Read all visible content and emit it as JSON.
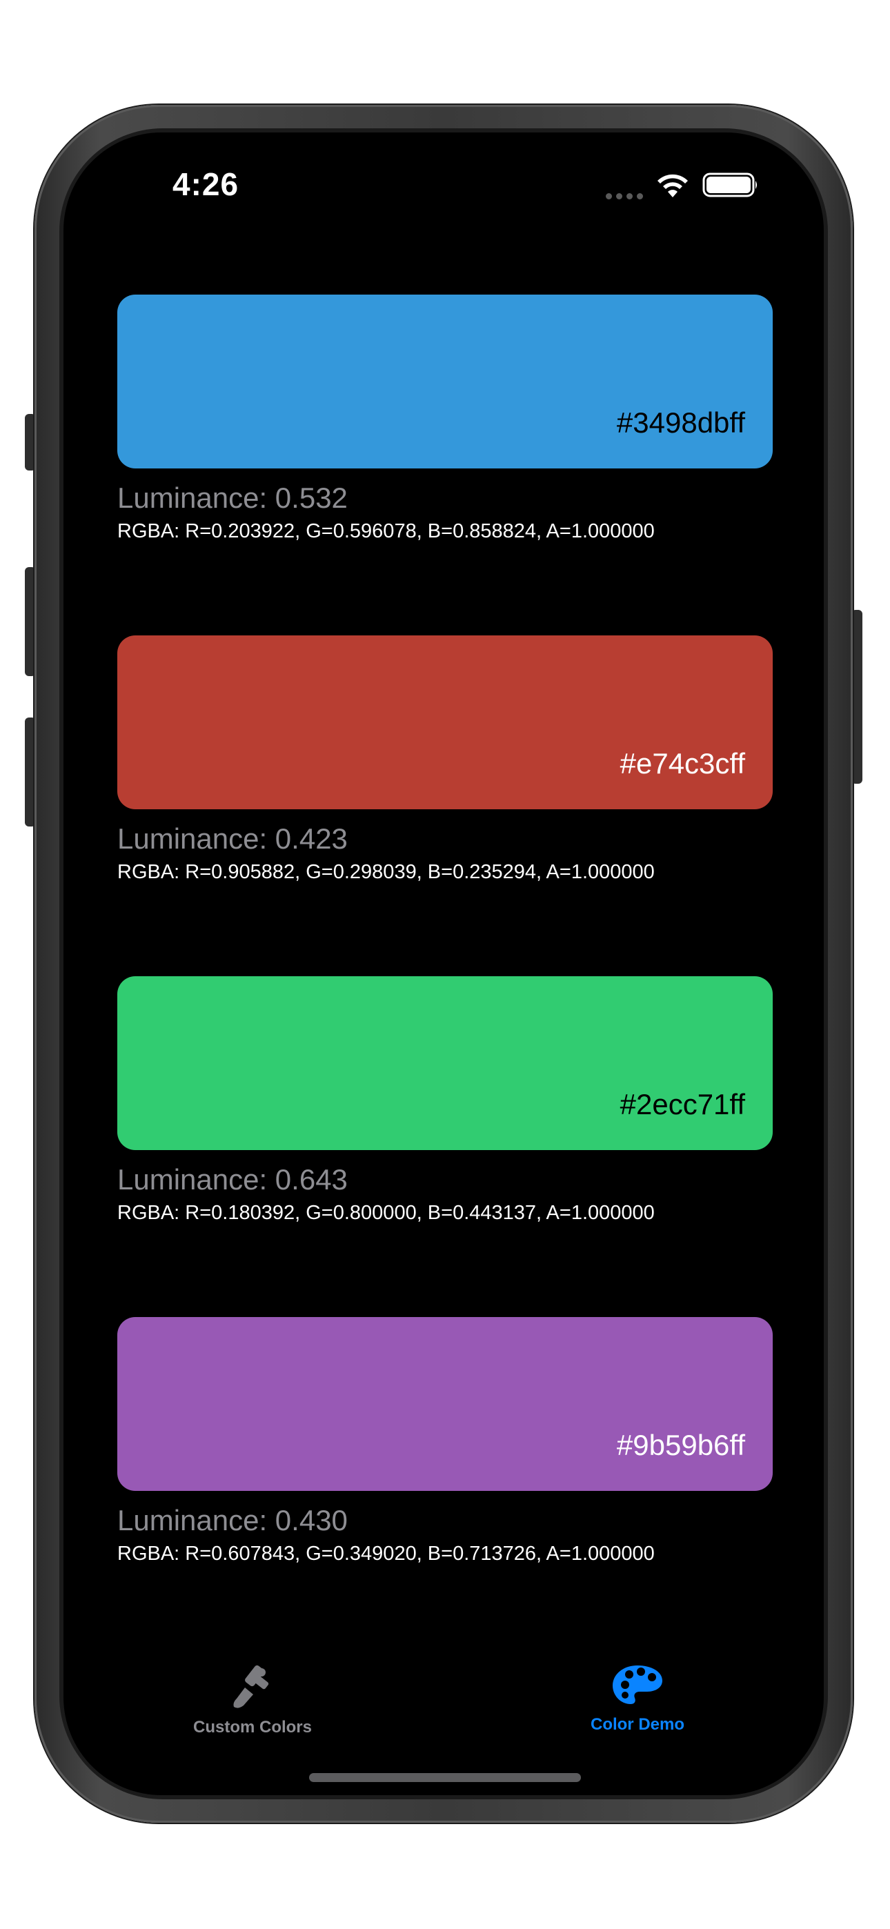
{
  "status_bar": {
    "time": "4:26",
    "icons": [
      "cellular-dots-icon",
      "wifi-icon",
      "battery-icon"
    ]
  },
  "colors": [
    {
      "hex": "#3498dbff",
      "swatch_color": "#3498db",
      "text_color": "#000000",
      "luminance_label": "Luminance: 0.532",
      "rgba_label": "RGBA: R=0.203922, G=0.596078, B=0.858824, A=1.000000"
    },
    {
      "hex": "#e74c3cff",
      "swatch_color": "#b83e32",
      "text_color": "#ffffff",
      "luminance_label": "Luminance: 0.423",
      "rgba_label": "RGBA: R=0.905882, G=0.298039, B=0.235294, A=1.000000"
    },
    {
      "hex": "#2ecc71ff",
      "swatch_color": "#31cc71",
      "text_color": "#000000",
      "luminance_label": "Luminance: 0.643",
      "rgba_label": "RGBA: R=0.180392, G=0.800000, B=0.443137, A=1.000000"
    },
    {
      "hex": "#9b59b6ff",
      "swatch_color": "#9859b5",
      "text_color": "#ffffff",
      "luminance_label": "Luminance: 0.430",
      "rgba_label": "RGBA: R=0.607843, G=0.349020, B=0.713726, A=1.000000"
    }
  ],
  "tab_bar": {
    "tabs": [
      {
        "label": "Custom Colors",
        "icon": "paintbrush-icon",
        "selected": false,
        "color": "#8e8e93"
      },
      {
        "label": "Color Demo",
        "icon": "palette-icon",
        "selected": true,
        "color": "#0a84ff"
      }
    ]
  }
}
